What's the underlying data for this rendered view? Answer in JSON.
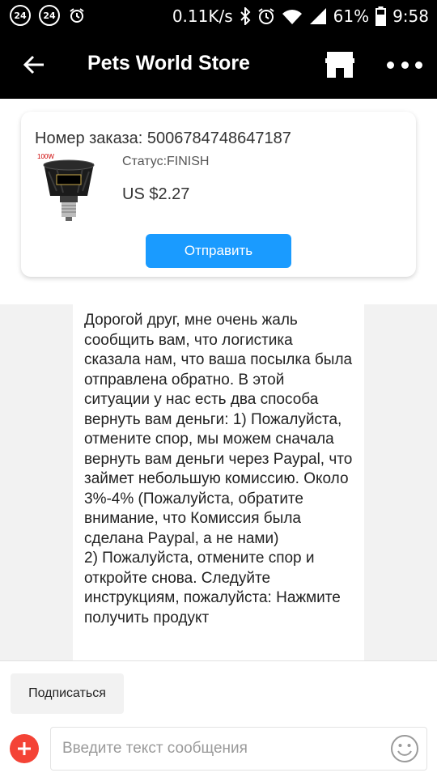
{
  "status_bar": {
    "badge1": "24",
    "badge2": "24",
    "speed": "0.11K/s",
    "battery": "61%",
    "time": "9:58"
  },
  "header": {
    "title": "Pets World Store"
  },
  "order": {
    "order_number": "Номер заказа: 5006784748647187",
    "status": "Статус:FINISH",
    "price": "US $2.27",
    "thumb_label": "100W",
    "send_label": "Отправить"
  },
  "message": {
    "text": "Дорогой друг, мне очень жаль сообщить вам, что логистика сказала нам, что ваша посылка была отправлена обратно. В этой ситуации у нас есть два способа вернуть вам деньги: 1) Пожалуйста, отмените спор, мы можем сначала вернуть вам деньги через Paypal, что займет небольшую комиссию. Около 3%-4% (Пожалуйста, обратите внимание, что Комиссия была сделана Paypal, а не нами)\n2) Пожалуйста, отмените спор и откройте снова. Следуйте инструкциям, пожалуйста: Нажмите получить продукт"
  },
  "footer": {
    "subscribe_label": "Подписаться",
    "input_placeholder": "Введите текст сообщения"
  },
  "colors": {
    "accent": "#1a9bff",
    "plus": "#f44336",
    "header_bg": "#000000"
  }
}
